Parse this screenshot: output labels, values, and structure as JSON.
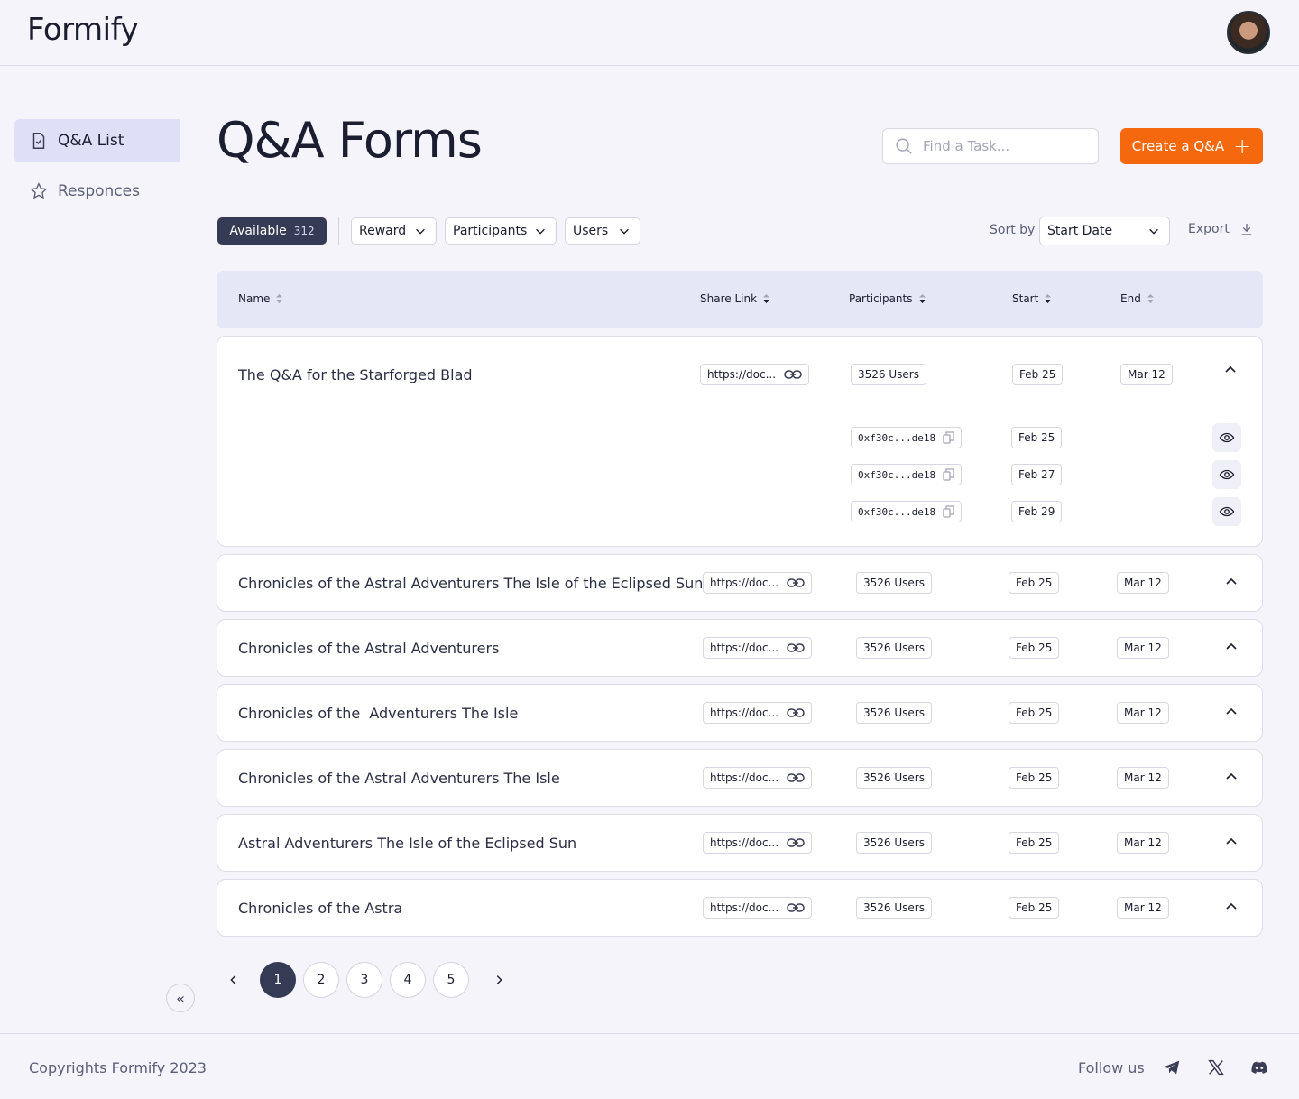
{
  "app": {
    "logo": "Formify"
  },
  "sidebar": {
    "items": [
      {
        "label": "Q&A List",
        "icon": "document-check-icon",
        "active": true
      },
      {
        "label": "Responces",
        "icon": "star-icon",
        "active": false
      }
    ],
    "collapse_label": "«"
  },
  "header": {
    "title": "Q&A Forms",
    "search_placeholder": "Find a Task...",
    "create_label": "Create a Q&A",
    "create_icon": "+"
  },
  "filters": {
    "available_label": "Available",
    "available_count": "312",
    "dropdowns": [
      "Reward",
      "Participants",
      "Users"
    ],
    "sort_label": "Sort by",
    "sort_value": "Start Date",
    "export_label": "Export"
  },
  "table": {
    "columns": [
      "Name",
      "Share Link",
      "Participants",
      "Start",
      "End"
    ],
    "rows": [
      {
        "name": "The Q&A for the Starforged Blad",
        "link": "https://doc...",
        "participants": "3526 Users",
        "start": "Feb 25",
        "end": "Mar 12",
        "expanded": true,
        "sub": [
          {
            "address": "0xf30c...de18",
            "date": "Feb 25"
          },
          {
            "address": "0xf30c...de18",
            "date": "Feb 27"
          },
          {
            "address": "0xf30c...de18",
            "date": "Feb 29"
          }
        ]
      },
      {
        "name": "Chronicles of the Astral Adventurers The Isle of the Eclipsed Sun",
        "link": "https://doc...",
        "participants": "3526 Users",
        "start": "Feb 25",
        "end": "Mar 12"
      },
      {
        "name": "Chronicles of the Astral Adventurers",
        "link": "https://doc...",
        "participants": "3526 Users",
        "start": "Feb 25",
        "end": "Mar 12"
      },
      {
        "name": "Chronicles of the  Adventurers The Isle",
        "link": "https://doc...",
        "participants": "3526 Users",
        "start": "Feb 25",
        "end": "Mar 12"
      },
      {
        "name": "Chronicles of the Astral Adventurers The Isle",
        "link": "https://doc...",
        "participants": "3526 Users",
        "start": "Feb 25",
        "end": "Mar 12"
      },
      {
        "name": "Astral Adventurers The Isle of the Eclipsed Sun",
        "link": "https://doc...",
        "participants": "3526 Users",
        "start": "Feb 25",
        "end": "Mar 12"
      },
      {
        "name": "Chronicles of the Astra",
        "link": "https://doc...",
        "participants": "3526 Users",
        "start": "Feb 25",
        "end": "Mar 12"
      }
    ]
  },
  "pagination": {
    "pages": [
      "1",
      "2",
      "3",
      "4",
      "5"
    ],
    "current": "1"
  },
  "footer": {
    "copyright": "Copyrights Formify 2023",
    "follow": "Follow us",
    "socials": [
      "telegram-icon",
      "x-icon",
      "discord-icon"
    ]
  },
  "colors": {
    "accent": "#f5680d",
    "dark": "#353a55",
    "background": "#f4f4fa",
    "active_nav": "#dfe0f7"
  }
}
